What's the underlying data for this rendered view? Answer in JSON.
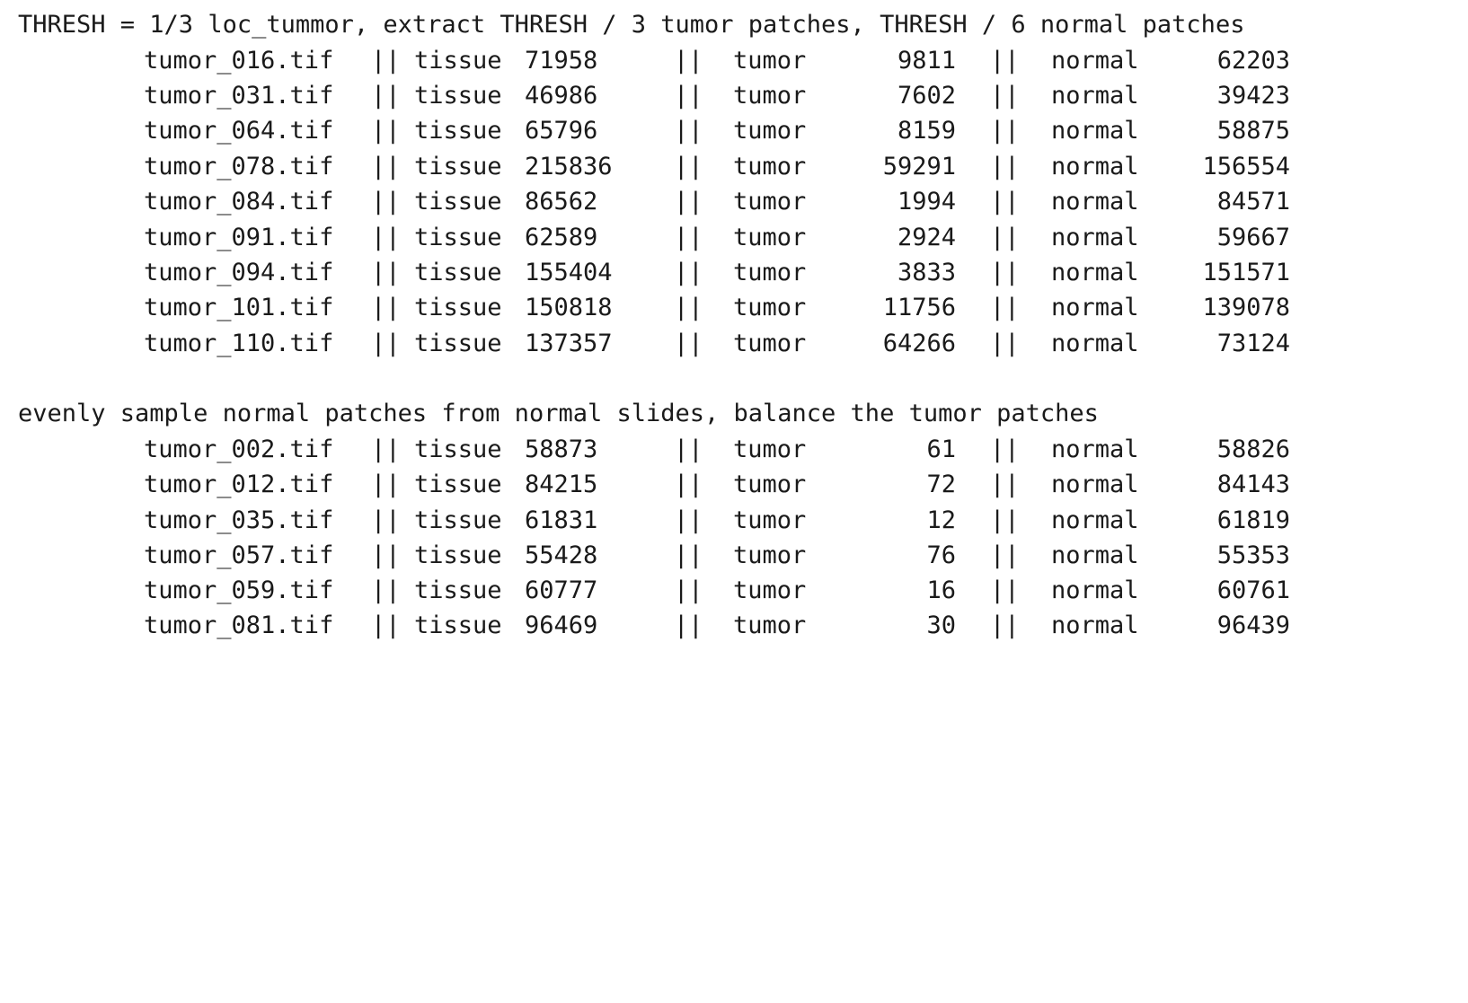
{
  "sections": [
    {
      "heading": "THRESH = 1/3 loc_tummor, extract THRESH / 3 tumor patches, THRESH / 6 normal patches",
      "rows": [
        {
          "file": "tumor_016.tif",
          "tissue": "71958",
          "tumor": "9811",
          "normal": "62203"
        },
        {
          "file": "tumor_031.tif",
          "tissue": "46986",
          "tumor": "7602",
          "normal": "39423"
        },
        {
          "file": "tumor_064.tif",
          "tissue": "65796",
          "tumor": "8159",
          "normal": "58875"
        },
        {
          "file": "tumor_078.tif",
          "tissue": "215836",
          "tumor": "59291",
          "normal": "156554"
        },
        {
          "file": "tumor_084.tif",
          "tissue": "86562",
          "tumor": "1994",
          "normal": "84571"
        },
        {
          "file": "tumor_091.tif",
          "tissue": "62589",
          "tumor": "2924",
          "normal": "59667"
        },
        {
          "file": "tumor_094.tif",
          "tissue": "155404",
          "tumor": "3833",
          "normal": "151571"
        },
        {
          "file": "tumor_101.tif",
          "tissue": "150818",
          "tumor": "11756",
          "normal": "139078"
        },
        {
          "file": "tumor_110.tif",
          "tissue": "137357",
          "tumor": "64266",
          "normal": "73124"
        }
      ]
    },
    {
      "heading": "evenly sample normal patches from normal slides, balance the tumor patches",
      "rows": [
        {
          "file": "tumor_002.tif",
          "tissue": "58873",
          "tumor": "61",
          "normal": "58826"
        },
        {
          "file": "tumor_012.tif",
          "tissue": "84215",
          "tumor": "72",
          "normal": "84143"
        },
        {
          "file": "tumor_035.tif",
          "tissue": "61831",
          "tumor": "12",
          "normal": "61819"
        },
        {
          "file": "tumor_057.tif",
          "tissue": "55428",
          "tumor": "76",
          "normal": "55353"
        },
        {
          "file": "tumor_059.tif",
          "tissue": "60777",
          "tumor": "16",
          "normal": "60761"
        },
        {
          "file": "tumor_081.tif",
          "tissue": "96469",
          "tumor": "30",
          "normal": "96439"
        }
      ]
    }
  ],
  "labels": {
    "separator": "||",
    "tissue": "tissue",
    "tumor": "tumor",
    "normal": "normal"
  }
}
